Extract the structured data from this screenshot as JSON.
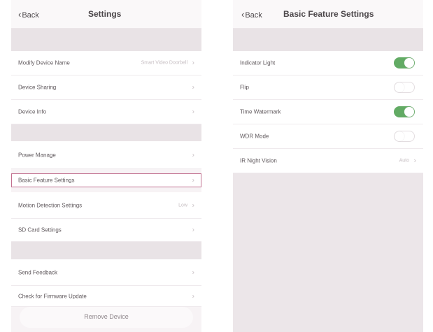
{
  "left": {
    "back_label": "Back",
    "title": "Settings",
    "rows": [
      {
        "label": "Modify Device Name",
        "value": "Smart Video Doorbell"
      },
      {
        "label": "Device Sharing",
        "value": ""
      },
      {
        "label": "Device Info",
        "value": ""
      },
      {
        "label": "Power Manage",
        "value": ""
      },
      {
        "label": "Basic Feature Settings",
        "value": ""
      },
      {
        "label": "Motion Detection Settings",
        "value": "Low"
      },
      {
        "label": "SD Card Settings",
        "value": ""
      },
      {
        "label": "Send Feedback",
        "value": ""
      },
      {
        "label": "Check for Firmware Update",
        "value": ""
      }
    ],
    "remove_label": "Remove Device"
  },
  "right": {
    "back_label": "Back",
    "title": "Basic Feature Settings",
    "rows": [
      {
        "label": "Indicator Light",
        "toggle": "on"
      },
      {
        "label": "Flip",
        "toggle": "off"
      },
      {
        "label": "Time Watermark",
        "toggle": "on"
      },
      {
        "label": "WDR Mode",
        "toggle": "off"
      },
      {
        "label": "IR Night Vision",
        "value": "Auto"
      }
    ]
  },
  "colors": {
    "toggle_on": "#62ab64",
    "highlight_border": "#c2708f",
    "section_band": "#e9e3e6"
  }
}
